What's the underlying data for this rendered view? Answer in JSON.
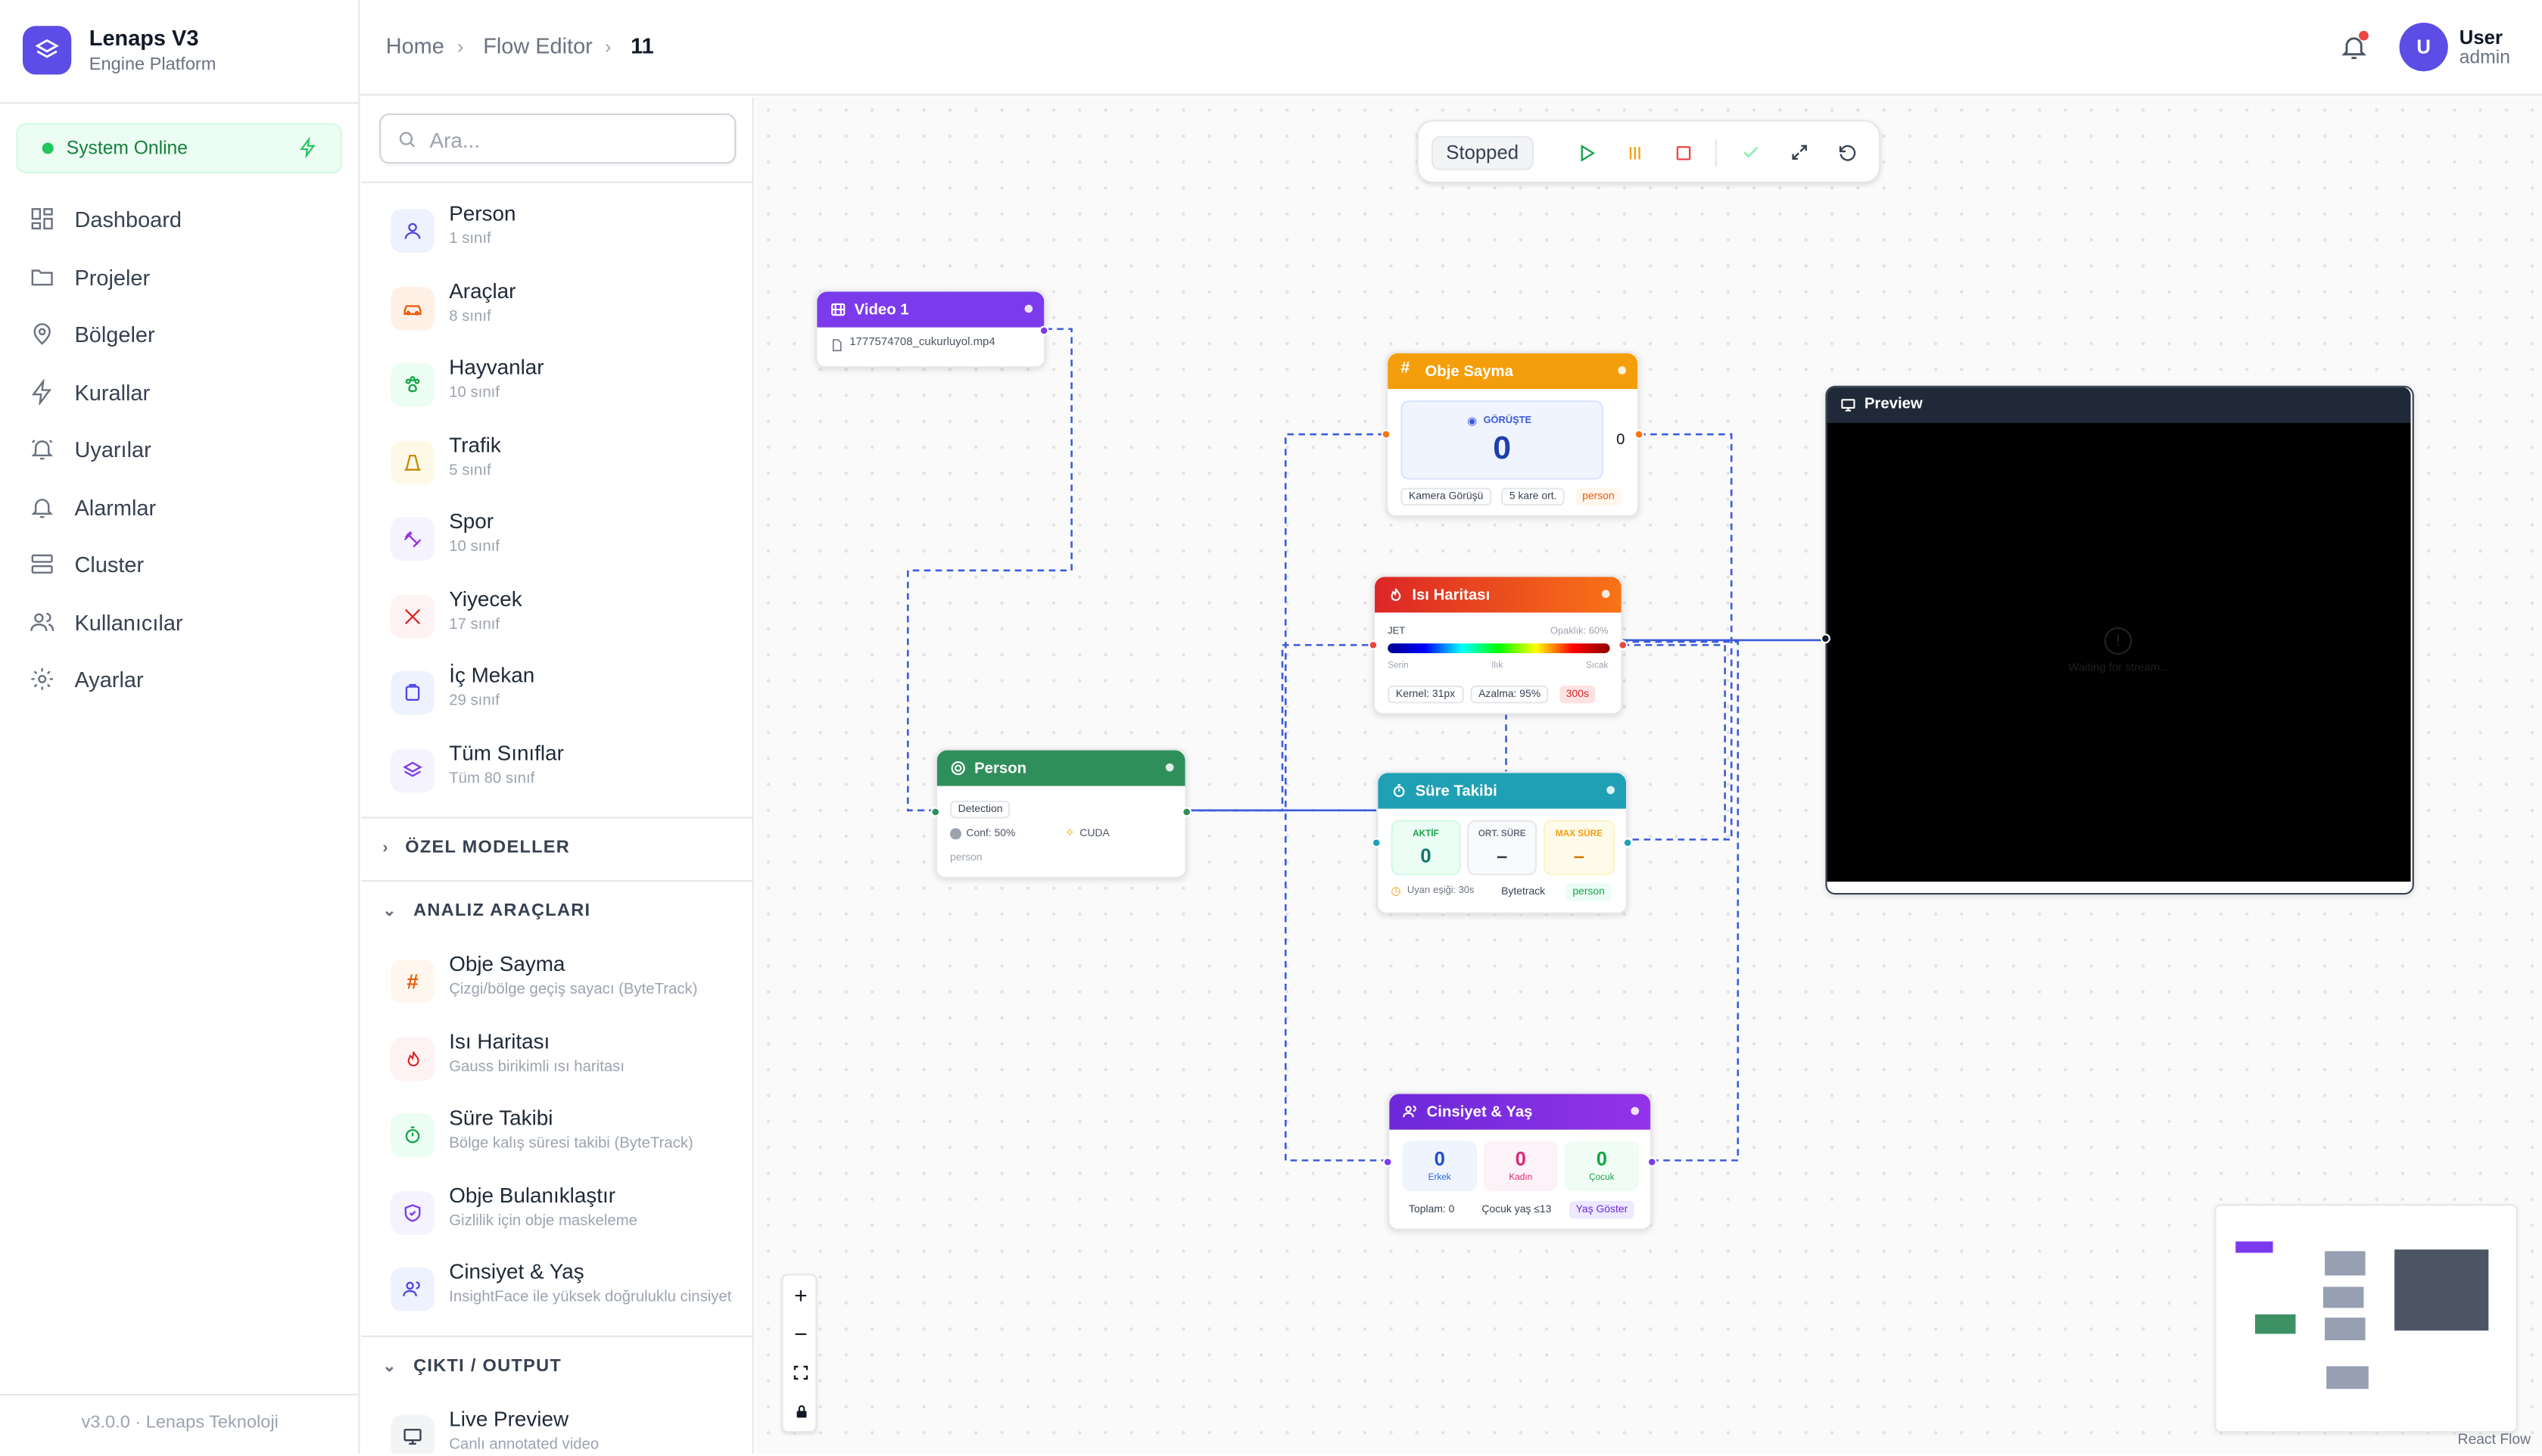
{
  "brand": {
    "title": "Lenaps V3",
    "subtitle": "Engine Platform"
  },
  "status": {
    "label": "System Online",
    "color": "#22c55e"
  },
  "nav": [
    {
      "label": "Dashboard",
      "icon": "dashboard-icon"
    },
    {
      "label": "Projeler",
      "icon": "folder-icon"
    },
    {
      "label": "Bölgeler",
      "icon": "map-pin-icon"
    },
    {
      "label": "Kurallar",
      "icon": "zap-icon"
    },
    {
      "label": "Uyarılar",
      "icon": "bell-ring-icon"
    },
    {
      "label": "Alarmlar",
      "icon": "bell-icon"
    },
    {
      "label": "Cluster",
      "icon": "server-icon"
    },
    {
      "label": "Kullanıcılar",
      "icon": "users-icon"
    },
    {
      "label": "Ayarlar",
      "icon": "settings-icon"
    }
  ],
  "version": "v3.0.0 · Lenaps Teknoloji",
  "breadcrumb": {
    "home": "Home",
    "editor": "Flow Editor",
    "current": "11"
  },
  "user": {
    "initial": "U",
    "name": "User",
    "role": "admin"
  },
  "search": {
    "placeholder": "Ara..."
  },
  "classes": [
    {
      "name": "Person",
      "count": "1 sınıf"
    },
    {
      "name": "Araçlar",
      "count": "8 sınıf"
    },
    {
      "name": "Hayvanlar",
      "count": "10 sınıf"
    },
    {
      "name": "Trafik",
      "count": "5 sınıf"
    },
    {
      "name": "Spor",
      "count": "10 sınıf"
    },
    {
      "name": "Yiyecek",
      "count": "17 sınıf"
    },
    {
      "name": "İç Mekan",
      "count": "29 sınıf"
    },
    {
      "name": "Tüm Sınıflar",
      "count": "Tüm 80 sınıf"
    }
  ],
  "sections": {
    "custom": "ÖZEL MODELLER",
    "analysis": "ANALIZ ARAÇLARI",
    "output": "ÇIKTI / OUTPUT"
  },
  "tools": [
    {
      "name": "Obje Sayma",
      "desc": "Çizgi/bölge geçiş sayacı (ByteTrack)"
    },
    {
      "name": "Isı Haritası",
      "desc": "Gauss birikimli ısı haritası"
    },
    {
      "name": "Süre Takibi",
      "desc": "Bölge kalış süresi takibi (ByteTrack)"
    },
    {
      "name": "Obje Bulanıklaştır",
      "desc": "Gizlilik için obje maskeleme"
    },
    {
      "name": "Cinsiyet & Yaş",
      "desc": "InsightFace ile yüksek doğruluklu cinsiyet"
    }
  ],
  "outputs": [
    {
      "name": "Live Preview",
      "desc": "Canlı annotated video"
    }
  ],
  "toolbar": {
    "status": "Stopped"
  },
  "nodes": {
    "video": {
      "title": "Video 1",
      "file": "1777574708_cukurluyol.mp4"
    },
    "person": {
      "title": "Person",
      "tag": "Detection",
      "conf": "Conf: 50%",
      "device": "CUDA",
      "cls": "person"
    },
    "count": {
      "title": "Obje Sayma",
      "mode": "GÖRÜŞTE",
      "value": "0",
      "side": "0",
      "p1": "Kamera Görüşü",
      "p2": "5 kare ort.",
      "p3": "person"
    },
    "heat": {
      "title": "Isı Haritası",
      "cmap": "JET",
      "opacity": "Opaklık: 60%",
      "l1": "Serin",
      "l2": "Ilık",
      "l3": "Sıcak",
      "p1": "Kernel: 31px",
      "p2": "Azalma: 95%",
      "p3": "300s"
    },
    "dwell": {
      "title": "Süre Takibi",
      "a_label": "AKTİF",
      "a_val": "0",
      "b_label": "ORT. SÜRE",
      "b_val": "–",
      "c_label": "MAX SÜRE",
      "c_val": "–",
      "p1": "Uyarı eşiği: 30s",
      "p2": "Bytetrack",
      "p3": "person"
    },
    "gender": {
      "title": "Cinsiyet & Yaş",
      "m_val": "0",
      "m_label": "Erkek",
      "f_val": "0",
      "f_label": "Kadın",
      "c_val": "0",
      "c_label": "Çocuk",
      "p1": "Toplam: 0",
      "p2": "Çocuk yaş ≤13",
      "p3": "Yaş Göster"
    },
    "preview": {
      "title": "Preview",
      "waiting": "Waiting for stream..."
    }
  },
  "attribution": "React Flow",
  "colors": {
    "accent": "#5b4de6",
    "video": "#7c3aed",
    "person": "#2f8f5b",
    "count": "#f59e0b",
    "heat": "#ef4444",
    "dwell": "#1fa0b5",
    "gender": "#7c3aed",
    "edge": "#3b5bdb"
  }
}
